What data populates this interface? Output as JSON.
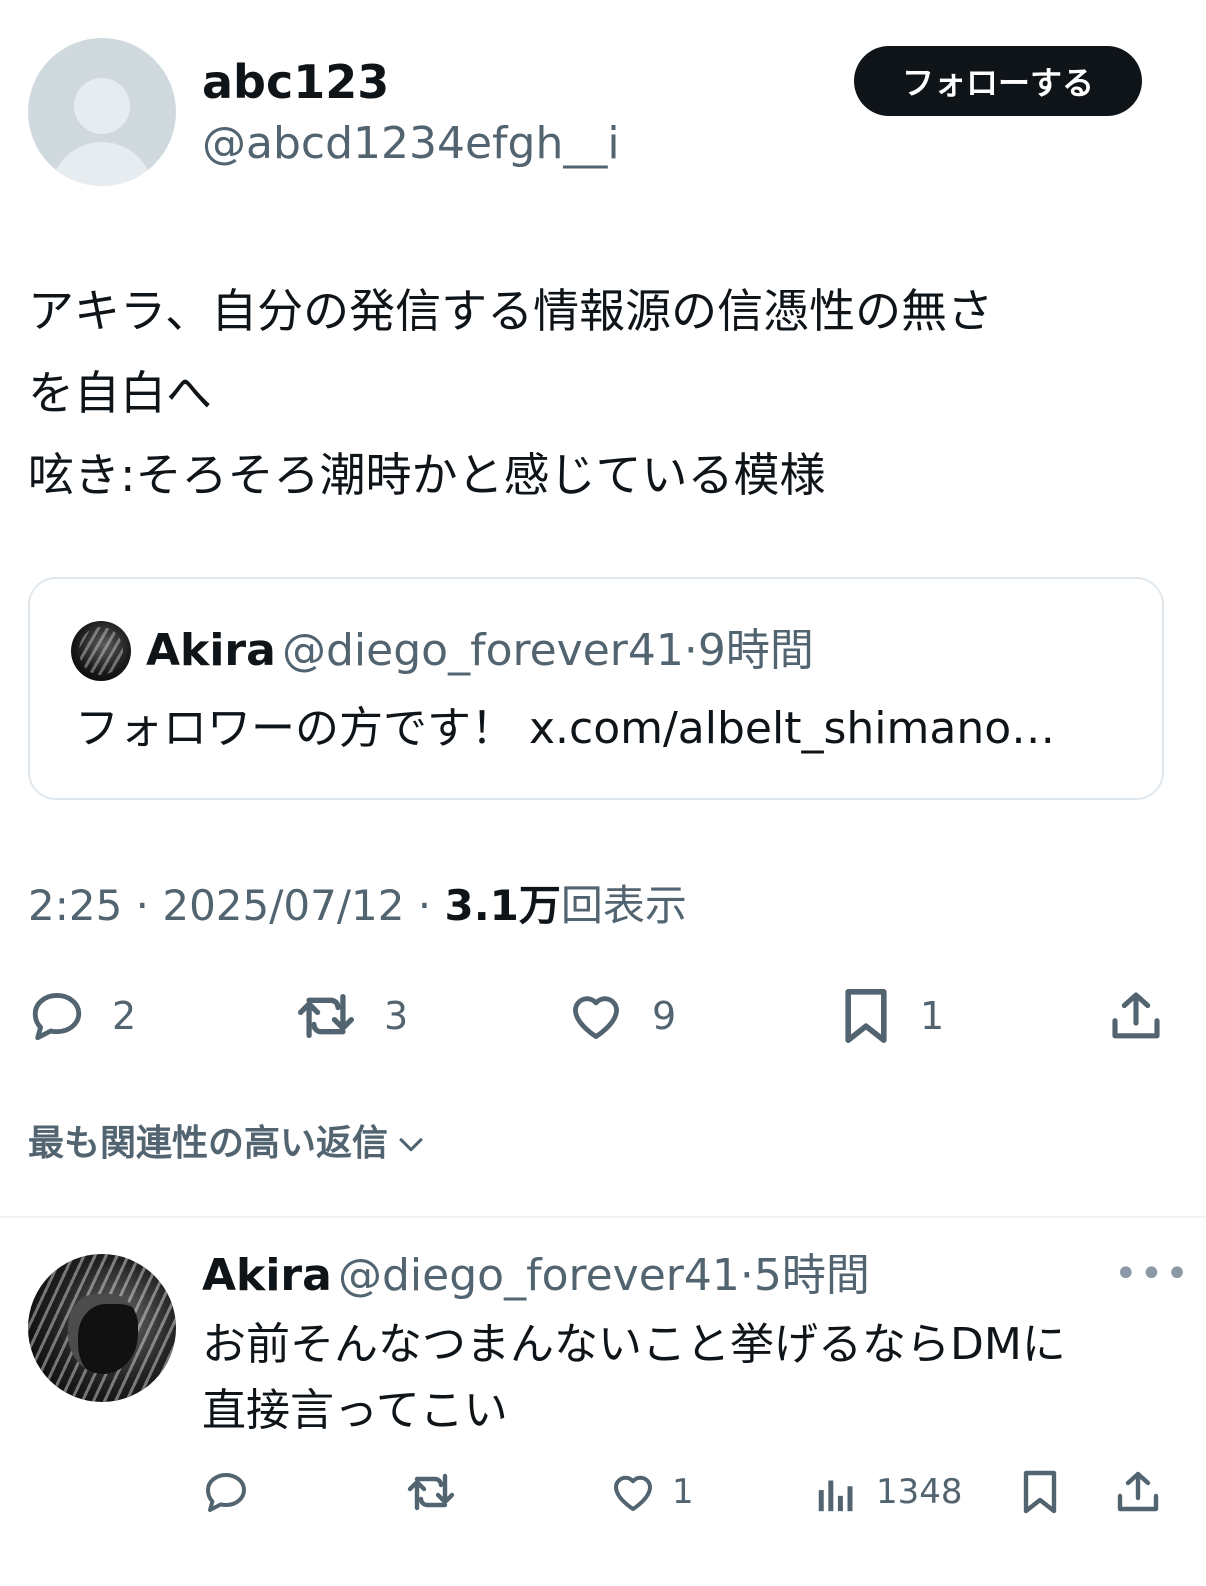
{
  "author": {
    "display_name": "abc123",
    "handle": "@abcd1234efgh__i",
    "avatar_icon": "default-avatar-icon"
  },
  "follow_button": {
    "label": "フォローする"
  },
  "tweet": {
    "lines": [
      "アキラ、自分の発信する情報源の信憑性の無さ",
      "を自白へ",
      "呟き:そろそろ潮時かと感じている模様"
    ]
  },
  "quote": {
    "name": "Akira",
    "handle_time": "@diego_forever41·9時間",
    "text": "フォロワーの方です！ x.com/albelt_shimano…"
  },
  "meta": {
    "time_date": "2:25 · 2025/07/12 · ",
    "views_count": "3.1万",
    "views_label": "回表示"
  },
  "actions": {
    "replies": "2",
    "reposts": "3",
    "likes": "9",
    "bookmarks": "1"
  },
  "replies_sort": {
    "label": "最も関連性の高い返信"
  },
  "reply": {
    "name": "Akira",
    "handle_time": "@diego_forever41·5時間",
    "lines": [
      "お前そんなつまんないこと挙げるならDMに",
      "直接言ってこい"
    ],
    "more_icon": "•••",
    "actions": {
      "replies": "",
      "reposts": "",
      "likes": "1",
      "views": "1348"
    }
  },
  "colors": {
    "text_primary": "#0f1419",
    "text_secondary": "#536471",
    "border": "#e1e8ed",
    "button_bg": "#0f1419"
  }
}
